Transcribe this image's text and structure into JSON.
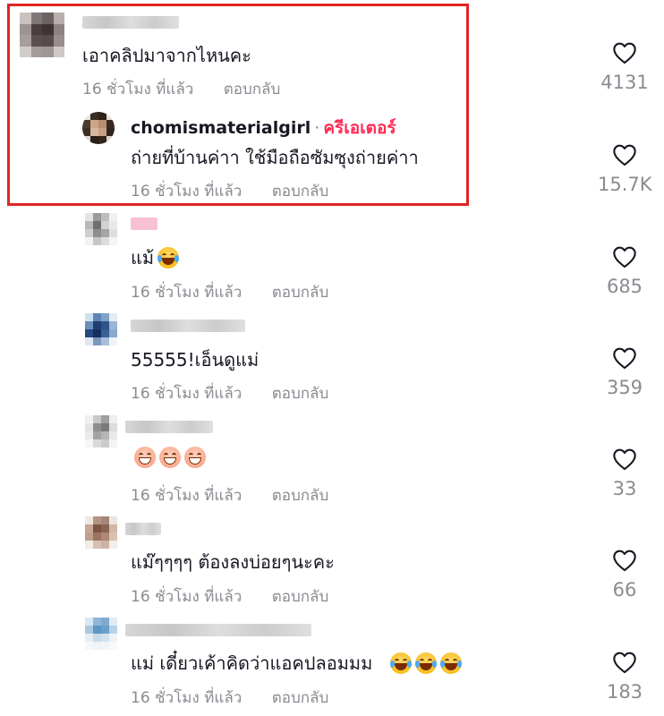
{
  "comments": [
    {
      "username_visible": "",
      "text": "เอาคลิปมาจากไหนคะ",
      "emojis": [],
      "time": "16 ชั่วโมง ที่แล้ว",
      "reply_label": "ตอบกลับ",
      "likes": "4131"
    },
    {
      "username_visible": "chomismaterialgirl",
      "separator": "·",
      "creator_badge": "ครีเอเตอร์",
      "text": "ถ่ายที่บ้านค่าา ใช้มือถือซัมซุงถ่ายค่าา",
      "emojis": [],
      "time": "16 ชั่วโมง ที่แล้ว",
      "reply_label": "ตอบกลับ",
      "likes": "15.7K"
    },
    {
      "username_visible": "",
      "text": "แม้",
      "emojis": [
        "tears-of-joy"
      ],
      "time": "16 ชั่วโมง ที่แล้ว",
      "reply_label": "ตอบกลับ",
      "likes": "685"
    },
    {
      "username_visible": "",
      "text": "55555!เอ็นดูแม่",
      "emojis": [],
      "time": "16 ชั่วโมง ที่แล้ว",
      "reply_label": "ตอบกลับ",
      "likes": "359"
    },
    {
      "username_visible": "",
      "text": "",
      "emojis": [
        "grin",
        "grin",
        "grin"
      ],
      "time": "16 ชั่วโมง ที่แล้ว",
      "reply_label": "ตอบกลับ",
      "likes": "33"
    },
    {
      "username_visible": "",
      "text": "แม๊ๆๆๆๆ ต้องลงบ่อยๆนะคะ",
      "emojis": [],
      "time": "16 ชั่วโมง ที่แล้ว",
      "reply_label": "ตอบกลับ",
      "likes": "66"
    },
    {
      "username_visible": "",
      "text": "แม่ เดี๋ยวเค้าคิดว่าแอคปลอมมม",
      "emojis": [
        "tears-of-joy",
        "tears-of-joy",
        "tears-of-joy"
      ],
      "time": "16 ชั่วโมง ที่แล้ว",
      "reply_label": "ตอบกลับ",
      "likes": "183"
    }
  ],
  "icons": {
    "like": "heart-outline-icon"
  },
  "colors": {
    "creator_badge": "#fe2c55",
    "meta_text": "#8a8b91",
    "highlight_border": "#e02424"
  }
}
